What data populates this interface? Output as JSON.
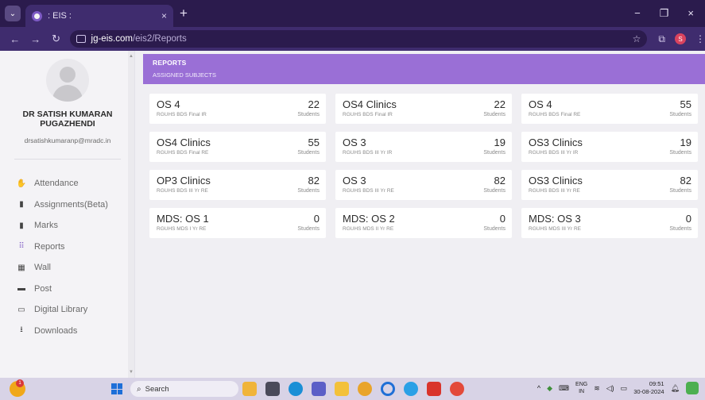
{
  "browser": {
    "tab_title": ": EIS :",
    "tab_close": "×",
    "new_tab": "+",
    "url_host": "jg-eis.com",
    "url_path": "/eis2/Reports",
    "controls": {
      "minimize": "−",
      "maximize": "❐",
      "close": "×"
    }
  },
  "sidebar": {
    "user_name_line1": "DR SATISH KUMARAN",
    "user_name_line2": "PUGAZHENDI",
    "user_email": "drsatishkumaranp@mradc.in",
    "items": [
      {
        "label": "Attendance",
        "icon": "hand-icon"
      },
      {
        "label": "Assignments(Beta)",
        "icon": "book-icon"
      },
      {
        "label": "Marks",
        "icon": "book-icon"
      },
      {
        "label": "Reports",
        "icon": "grid-icon"
      },
      {
        "label": "Wall",
        "icon": "wall-icon"
      },
      {
        "label": "Post",
        "icon": "post-icon"
      },
      {
        "label": "Digital Library",
        "icon": "library-icon"
      },
      {
        "label": "Downloads",
        "icon": "download-icon"
      }
    ]
  },
  "header": {
    "title": "REPORTS",
    "subtitle": "ASSIGNED SUBJECTS"
  },
  "cards": [
    {
      "title": "OS 4",
      "sub": "RGUHS BDS Final IR",
      "count": "22",
      "unit": "Students"
    },
    {
      "title": "OS4 Clinics",
      "sub": "RGUHS BDS Final IR",
      "count": "22",
      "unit": "Students"
    },
    {
      "title": "OS 4",
      "sub": "RGUHS BDS Final RE",
      "count": "55",
      "unit": "Students"
    },
    {
      "title": "OS4 Clinics",
      "sub": "RGUHS BDS Final RE",
      "count": "55",
      "unit": "Students"
    },
    {
      "title": "OS 3",
      "sub": "RGUHS BDS III Yr IR",
      "count": "19",
      "unit": "Students"
    },
    {
      "title": "OS3 Clinics",
      "sub": "RGUHS BDS III Yr IR",
      "count": "19",
      "unit": "Students"
    },
    {
      "title": "OP3 Clinics",
      "sub": "RGUHS BDS III Yr RE",
      "count": "82",
      "unit": "Students"
    },
    {
      "title": "OS 3",
      "sub": "RGUHS BDS III Yr RE",
      "count": "82",
      "unit": "Students"
    },
    {
      "title": "OS3 Clinics",
      "sub": "RGUHS BDS III Yr RE",
      "count": "82",
      "unit": "Students"
    },
    {
      "title": "MDS: OS 1",
      "sub": "RGUHS MDS I Yr RE",
      "count": "0",
      "unit": "Students"
    },
    {
      "title": "MDS: OS 2",
      "sub": "RGUHS MDS II Yr RE",
      "count": "0",
      "unit": "Students"
    },
    {
      "title": "MDS: OS 3",
      "sub": "RGUHS MDS III Yr RE",
      "count": "0",
      "unit": "Students"
    }
  ],
  "taskbar": {
    "search_placeholder": "Search",
    "lang_line1": "ENG",
    "lang_line2": "IN",
    "time": "09:51",
    "date": "30-08-2024",
    "weather_badge": "1"
  },
  "colors": {
    "accent": "#9a6fd6",
    "browser_dark": "#2b1b4d",
    "browser_mid": "#3f2c6e"
  }
}
